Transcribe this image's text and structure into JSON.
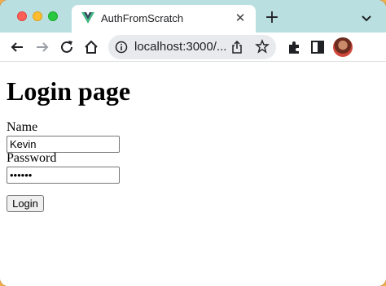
{
  "browser": {
    "tab": {
      "title": "AuthFromScratch",
      "close_glyph": "✕",
      "favicon": "vue-logo-icon"
    },
    "new_tab_glyph": "+",
    "address_bar": {
      "url": "localhost:3000/..."
    },
    "toolbar_icons": [
      "back-arrow-icon",
      "forward-arrow-icon",
      "reload-icon",
      "home-icon",
      "site-info-icon",
      "share-icon",
      "star-icon",
      "extensions-puzzle-icon",
      "side-panel-icon",
      "profile-avatar"
    ]
  },
  "page": {
    "title": "Login page",
    "form": {
      "name_label": "Name",
      "name_value": "Kevin",
      "password_label": "Password",
      "password_value": "••••••",
      "submit_label": "Login"
    }
  },
  "colors": {
    "tab_strip": "#b9dfe0",
    "omnibox": "#e8eaed",
    "desktop": "#f2ae4a"
  }
}
